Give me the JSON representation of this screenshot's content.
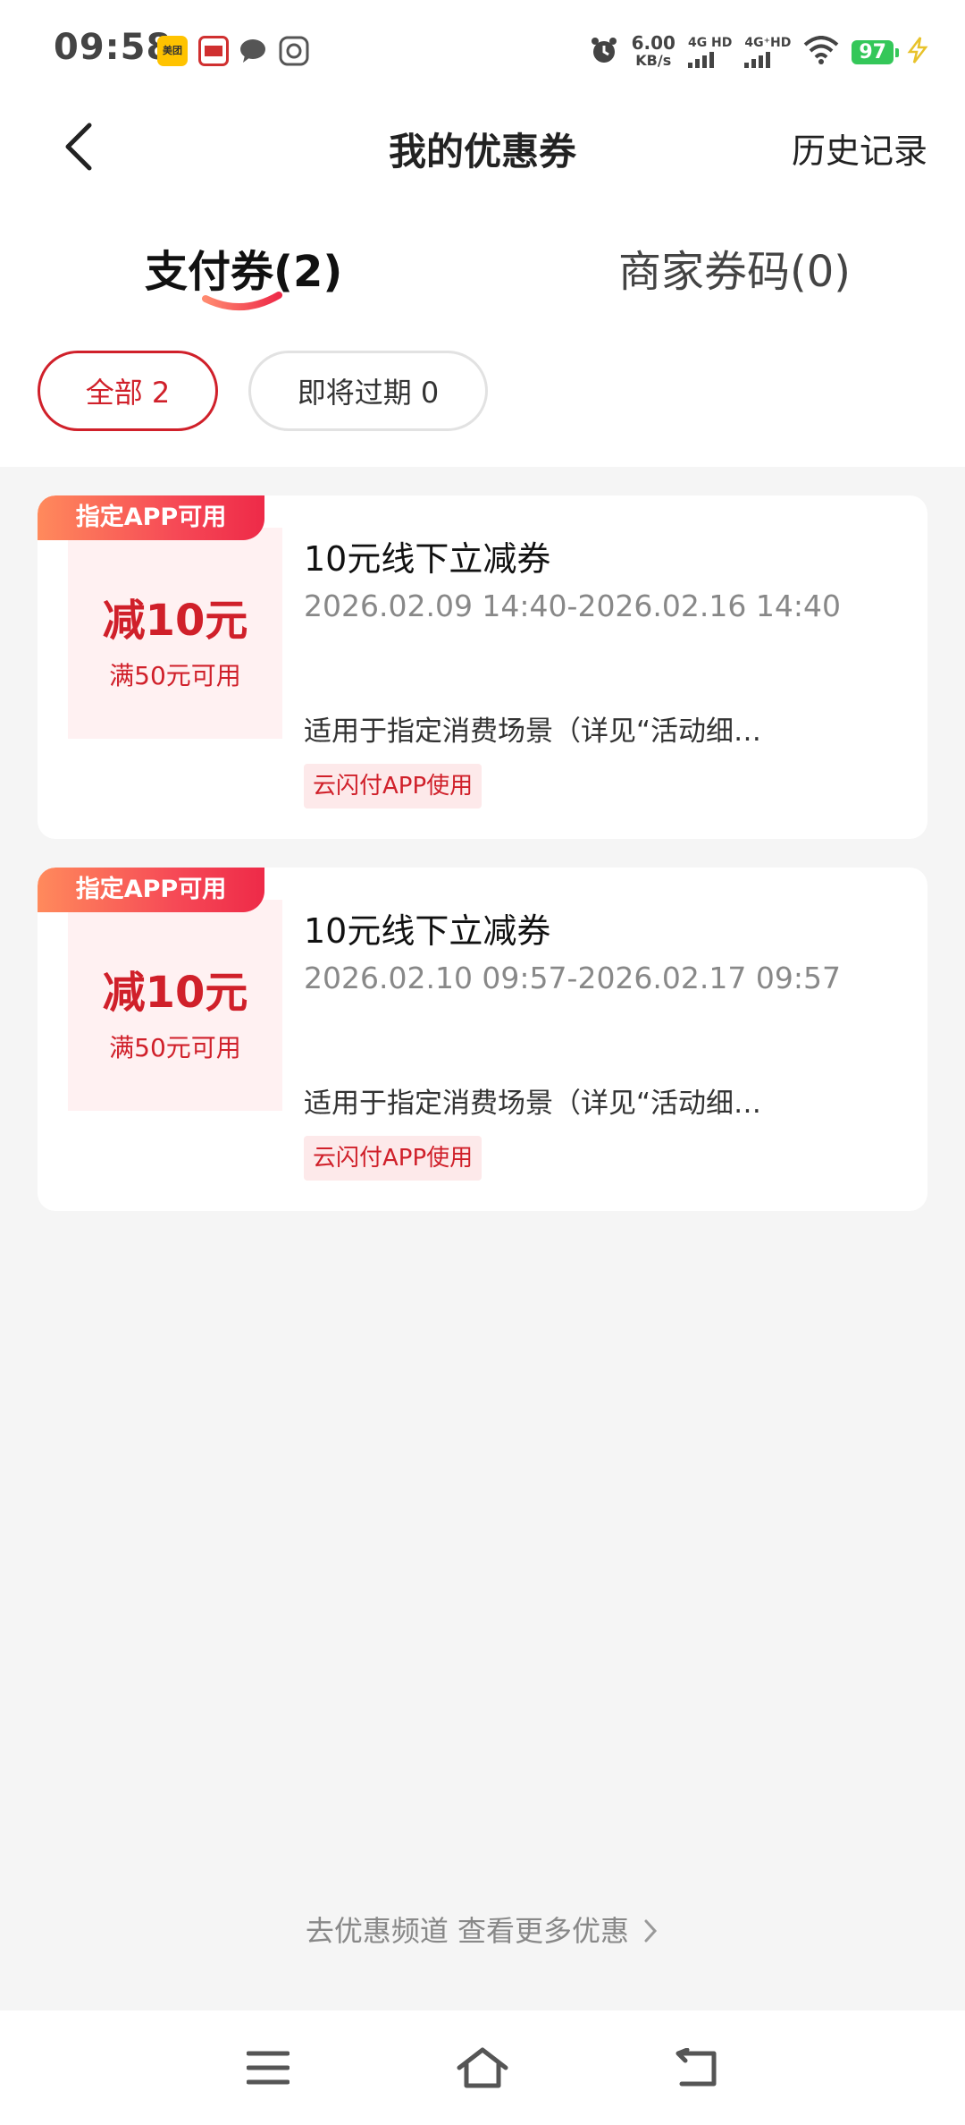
{
  "status_bar": {
    "time": "09:58",
    "meituan_label": "美团",
    "net_speed_value": "6.00",
    "net_speed_unit": "KB/s",
    "sim1_label": "4G HD",
    "sim2_label": "4G⁺HD",
    "battery": "97"
  },
  "header": {
    "title": "我的优惠券",
    "history": "历史记录"
  },
  "tabs": [
    {
      "label": "支付券(2)",
      "active": true
    },
    {
      "label": "商家券码(0)",
      "active": false
    }
  ],
  "filters": [
    {
      "label": "全部 2",
      "selected": true
    },
    {
      "label": "即将过期 0",
      "selected": false
    }
  ],
  "coupons": [
    {
      "badge": "指定APP可用",
      "amount": "减10元",
      "condition": "满50元可用",
      "title": "10元线下立减券",
      "dates": "2026.02.09 14:40-2026.02.16 14:40",
      "description": "适用于指定消费场景（详见“活动细…",
      "tag": "云闪付APP使用"
    },
    {
      "badge": "指定APP可用",
      "amount": "减10元",
      "condition": "满50元可用",
      "title": "10元线下立减券",
      "dates": "2026.02.10 09:57-2026.02.17 09:57",
      "description": "适用于指定消费场景（详见“活动细…",
      "tag": "云闪付APP使用"
    }
  ],
  "footer": {
    "more_link": "去优惠频道 查看更多优惠"
  },
  "colors": {
    "accent": "#d0202a",
    "badge_gradient_start": "#ff8a5c",
    "badge_gradient_end": "#ee2a48",
    "page_bg": "#f5f5f5"
  }
}
